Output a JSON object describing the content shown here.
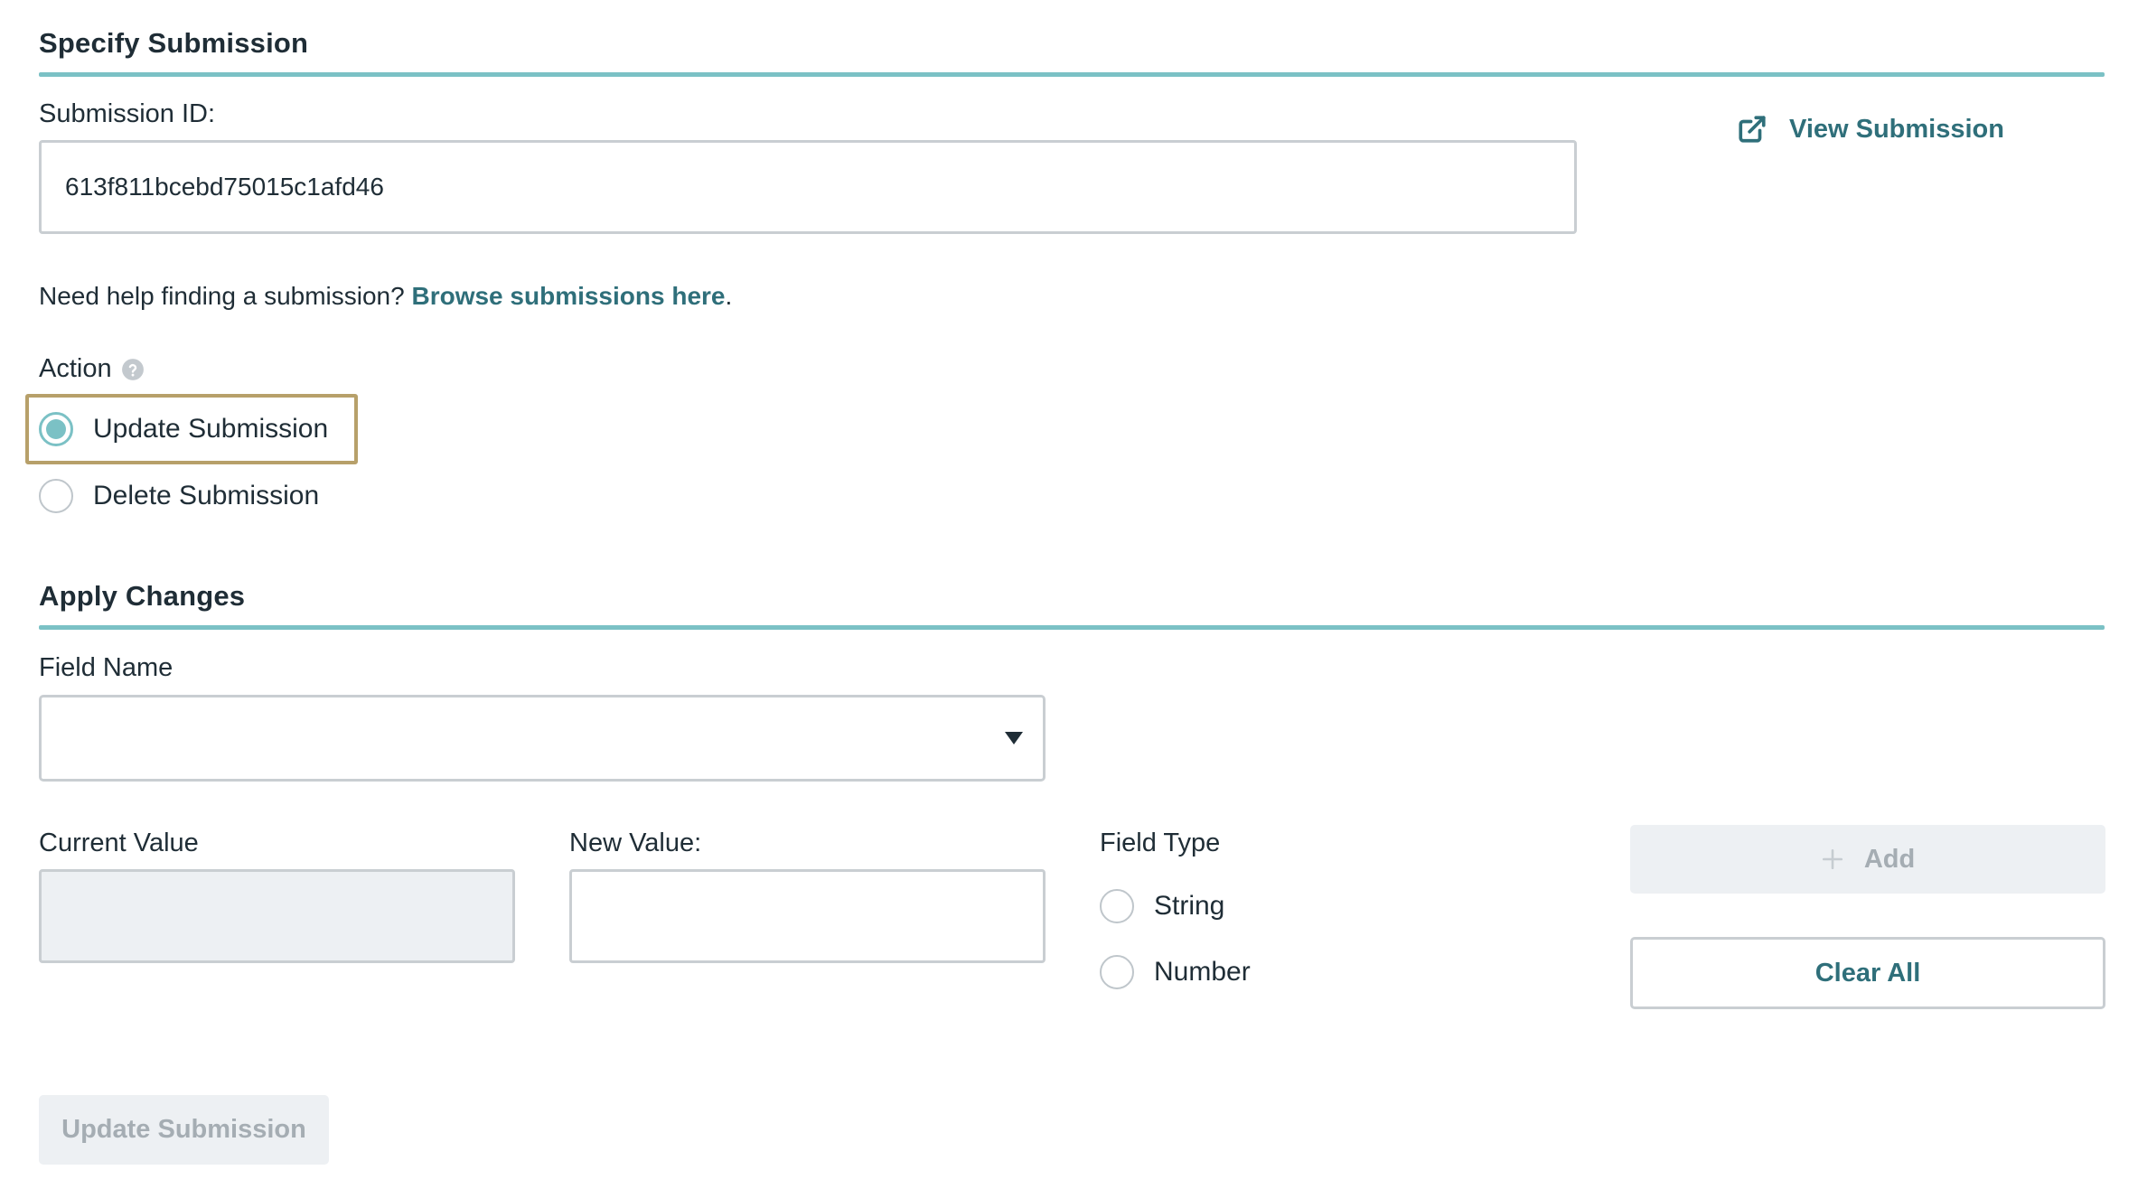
{
  "specify": {
    "title": "Specify Submission",
    "submission_id_label": "Submission ID:",
    "submission_id_value": "613f811bcebd75015c1afd46",
    "view_link_label": "View Submission",
    "view_link_icon": "external-link-icon",
    "help_text": "Need help finding a submission?",
    "help_link": "Browse submissions here",
    "help_suffix": "."
  },
  "action": {
    "label": "Action",
    "help_icon": "question-circle-icon",
    "options": [
      {
        "label": "Update Submission",
        "checked": true
      },
      {
        "label": "Delete Submission",
        "checked": false
      }
    ]
  },
  "apply": {
    "title": "Apply Changes",
    "field_name_label": "Field Name",
    "field_name_value": "",
    "current_value_label": "Current Value",
    "current_value": "",
    "new_value_label": "New Value:",
    "new_value": "",
    "field_type_label": "Field Type",
    "field_type_options": [
      {
        "label": "String",
        "checked": false
      },
      {
        "label": "Number",
        "checked": false
      }
    ],
    "add_button": "Add",
    "add_icon": "plus-icon",
    "clear_all_button": "Clear All"
  },
  "footer": {
    "submit_button": "Update Submission"
  },
  "colors": {
    "accent": "#7bc1c5",
    "link": "#2f6f7a",
    "focus_outline": "#b7a06a",
    "disabled_bg": "#edf0f3"
  }
}
